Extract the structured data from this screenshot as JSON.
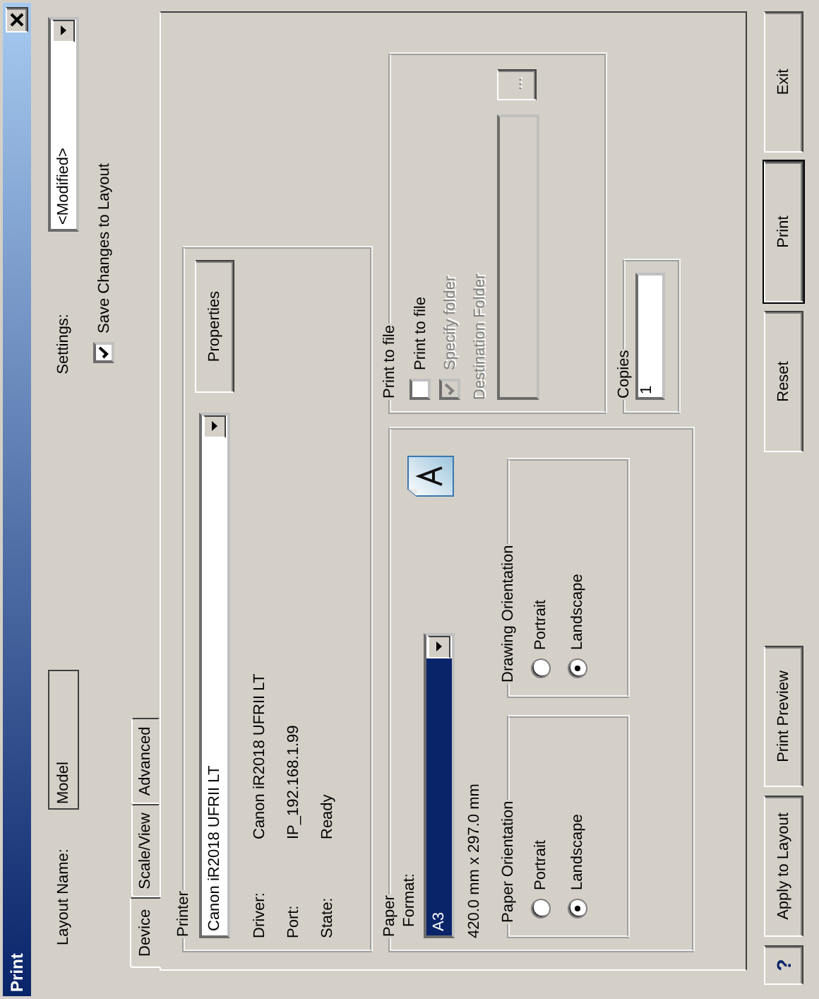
{
  "window": {
    "title": "Print"
  },
  "layout_name": {
    "label": "Layout Name:",
    "value": "Model"
  },
  "settings": {
    "label": "Settings:",
    "value": "<Modified>"
  },
  "save_changes": {
    "label": "Save Changes to Layout",
    "checked": true
  },
  "tabs": [
    {
      "label": "Device",
      "selected": true
    },
    {
      "label": "Scale/View",
      "selected": false
    },
    {
      "label": "Advanced",
      "selected": false
    }
  ],
  "printer": {
    "legend": "Printer",
    "selection": "Canon iR2018 UFRII LT",
    "properties_button": "Properties",
    "details": [
      {
        "label": "Driver:",
        "value": "Canon iR2018 UFRII LT"
      },
      {
        "label": "Port:",
        "value": "IP_192.168.1.99"
      },
      {
        "label": "State:",
        "value": "Ready"
      }
    ]
  },
  "paper": {
    "legend": "Paper",
    "format_label": "Format:",
    "format": "A3",
    "format_focused": true,
    "dimensions": "420.0 mm x 297.0 mm",
    "paper_orientation": {
      "legend": "Paper Orientation",
      "options": [
        {
          "label": "Portrait",
          "selected": false
        },
        {
          "label": "Landscape",
          "selected": true
        }
      ]
    },
    "drawing_orientation": {
      "legend": "Drawing Orientation",
      "options": [
        {
          "label": "Portrait",
          "selected": false
        },
        {
          "label": "Landscape",
          "selected": true
        }
      ]
    }
  },
  "print_to_file": {
    "legend": "Print to file",
    "options": [
      {
        "label": "Print to file",
        "checked": false,
        "disabled": false
      },
      {
        "label": "Specify folder",
        "checked": true,
        "disabled": true
      }
    ],
    "destination_label": "Destination Folder",
    "destination_disabled": true,
    "browse_button": "...",
    "browse_disabled": true
  },
  "copies": {
    "legend": "Copies",
    "value": "1"
  },
  "buttons_left": [
    {
      "label": "?",
      "kind": "help"
    },
    {
      "label": "Apply to Layout",
      "kind": "normal"
    },
    {
      "label": "Print Preview",
      "kind": "normal"
    }
  ],
  "buttons_right": [
    {
      "label": "Reset",
      "kind": "normal"
    },
    {
      "label": "Print",
      "kind": "default"
    },
    {
      "label": "Exit",
      "kind": "normal"
    }
  ]
}
